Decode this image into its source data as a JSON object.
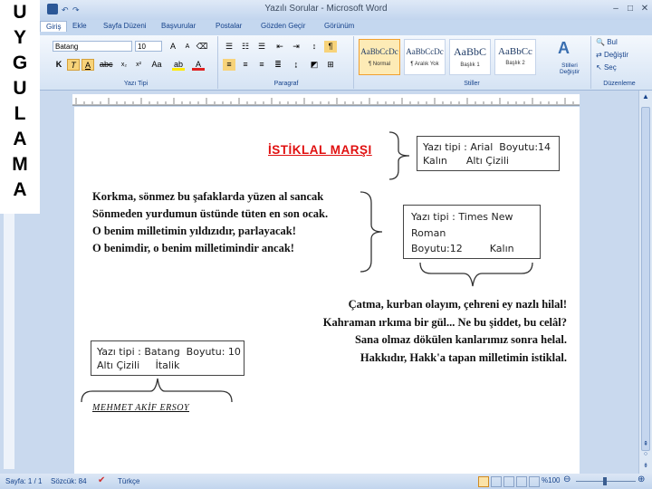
{
  "side_label": [
    "U",
    "Y",
    "G",
    "U",
    "L",
    "A",
    "M",
    "A"
  ],
  "window": {
    "title": "Yazılı Sorular - Microsoft Word",
    "buttons": [
      "–",
      "□",
      "✕"
    ]
  },
  "tabs": [
    "Giriş",
    "Ekle",
    "Sayfa Düzeni",
    "Başvurular",
    "Postalar",
    "Gözden Geçir",
    "Görünüm"
  ],
  "ribbon": {
    "font_name": "Batang",
    "font_size": "10",
    "group_font": "Yazı Tipi",
    "group_paragraph": "Paragraf",
    "group_styles": "Stiller",
    "group_editing": "Düzenleme",
    "font_buttons": [
      "K",
      "T",
      "A"
    ],
    "styles": [
      {
        "preview": "AaBbCcDc",
        "name": "¶ Normal"
      },
      {
        "preview": "AaBbCcDc",
        "name": "¶ Aralık Yok"
      },
      {
        "preview": "AaBbC",
        "name": "Başlık 1"
      },
      {
        "preview": "AaBbCc",
        "name": "Başlık 2"
      }
    ],
    "change_styles": "Stilleri Değiştir",
    "find": "Bul",
    "replace": "Değiştir",
    "select": "Seç"
  },
  "document": {
    "title": "İSTİKLAL MARŞI",
    "stanza1": [
      "Korkma, sönmez bu şafaklarda yüzen al sancak",
      "Sönmeden yurdumun üstünde tüten en son ocak.",
      "O benim milletimin yıldızıdır, parlayacak!",
      "O benimdir, o benim milletimindir ancak!"
    ],
    "stanza2": [
      "Çatma, kurban olayım, çehreni ey nazlı hilal!",
      "Kahraman ırkıma bir gül... Ne bu şiddet, bu celâl?",
      "Sana olmaz dökülen kanlarımız sonra helal.",
      "Hakkıdır, Hakk'a tapan milletimin istiklal."
    ],
    "author": "MEHMET AKİF ERSOY",
    "note1": {
      "line1": "Yazı tipi : Arial  Boyutu:14",
      "line2": "Kalın      Altı Çizili"
    },
    "note2": {
      "line1": "Yazı tipi : Times New",
      "line2": "Roman",
      "line3": "Boyutu:12",
      "line3b": "Kalın"
    },
    "note3": {
      "line1": "Yazı tipi : Batang  Boyutu: 10",
      "line2": "Altı Çizili     İtalik"
    }
  },
  "status": {
    "page": "Sayfa: 1 / 1",
    "words": "Sözcük: 84",
    "language": "Türkçe",
    "zoom": "%100"
  }
}
